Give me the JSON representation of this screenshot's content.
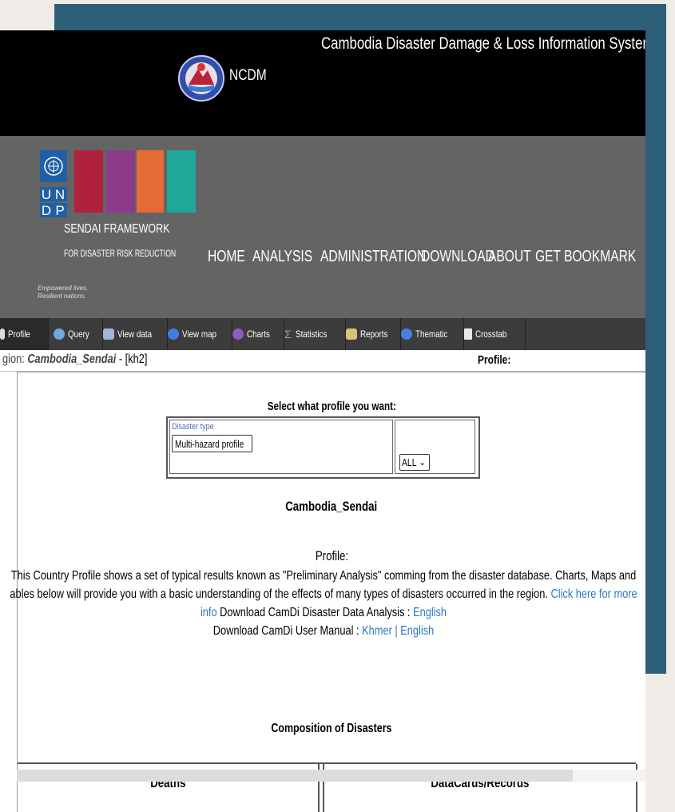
{
  "header": {
    "org_label": "NCDM",
    "system_title": "Cambodia Disaster Damage & Loss Information System (C"
  },
  "branding": {
    "undp_letters": [
      "U",
      "N",
      "D",
      "P"
    ],
    "undp_tagline_1": "Empowered lives.",
    "undp_tagline_2": "Resilient nations.",
    "sendai_title": "SENDAI FRAMEWORK",
    "sendai_subtitle": "FOR DISASTER RISK REDUCTION",
    "stripe_colors": [
      "#b0213d",
      "#8c3a8a",
      "#e46b35",
      "#1fa79a"
    ]
  },
  "main_nav": [
    "HOME",
    "ANALYSIS",
    "ADMINISTRATION",
    "DOWNLOAD",
    "ABOUT",
    "GET BOOKMARK"
  ],
  "tool_tabs": [
    {
      "label": "Profile",
      "icon": "profile-icon"
    },
    {
      "label": "Query",
      "icon": "query-icon"
    },
    {
      "label": "View data",
      "icon": "view-data-icon"
    },
    {
      "label": "View map",
      "icon": "globe-icon"
    },
    {
      "label": "Charts",
      "icon": "charts-icon"
    },
    {
      "label": "Statistics",
      "icon": "sigma-icon"
    },
    {
      "label": "Reports",
      "icon": "reports-icon"
    },
    {
      "label": "Thematic",
      "icon": "thematic-icon"
    },
    {
      "label": "Crosstab",
      "icon": "crosstab-icon"
    }
  ],
  "region": {
    "prefix": "gion: ",
    "name": "Cambodia_Sendai",
    "code": " - [kh2]",
    "profile_label": "Profile:"
  },
  "selector": {
    "title": "Select what profile you want:",
    "disaster_type_label": "Disaster type",
    "disaster_type_value": "Multi-hazard profile",
    "scope_value": "ALL"
  },
  "profile": {
    "region_title": "Cambodia_Sendai",
    "heading": "Profile:",
    "description": "This Country Profile shows a set of typical results known as \"Preliminary Analysis\" comming from the disaster database. Charts, Maps and ables below will provide you with a basic understanding of the effects of many types of disasters occurred in the region.",
    "more_info_link": "Click here for more info",
    "download_analysis_label": "Download CamDi Disaster Data Analysis :",
    "download_analysis_link": "English",
    "download_manual_label": "Download CamDi User Manual :",
    "manual_link_khmer": "Khmer",
    "manual_separator": "|",
    "manual_link_english": "English"
  },
  "composition": {
    "title": "Composition of Disasters",
    "col1": "Deaths",
    "col2": "DataCards/Records"
  },
  "colors": {
    "teal_panel": "#2e5f78",
    "header_black": "#000000",
    "band_grey": "#646464",
    "link_blue": "#2a78c0"
  }
}
